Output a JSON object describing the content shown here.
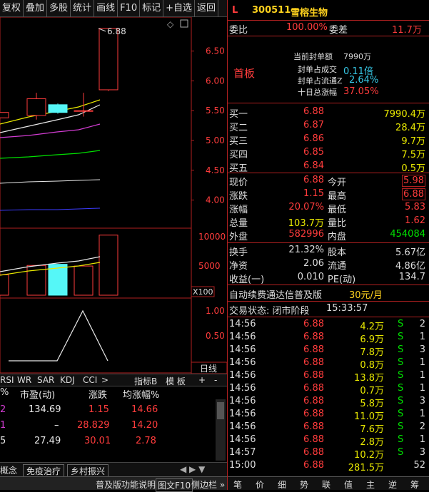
{
  "toolbar": [
    "复权",
    "叠加",
    "多股",
    "统计",
    "画线",
    "F10",
    "标记",
    "+自选",
    "返回"
  ],
  "price_axis": [
    "6.50",
    "6.00",
    "5.50",
    "5.00",
    "4.50",
    "4.00"
  ],
  "peak_label": "6.88",
  "vol_axis": [
    "10000",
    "5000"
  ],
  "vol_unit": "X100",
  "ind_axis": [
    "1.00",
    "0.50"
  ],
  "period_label": "日线",
  "ind_tabs": [
    "RSI",
    "WR",
    "SAR",
    "KDJ",
    "CCI",
    ">"
  ],
  "ind_tab_extra": [
    "指标B",
    "模 板",
    "+",
    "-"
  ],
  "table_headers": [
    "%",
    "市盈(动)",
    "涨跌",
    "均涨幅%"
  ],
  "table_rows": [
    {
      "a": "2",
      "b": "134.69",
      "c": "1.15",
      "d": "14.66"
    },
    {
      "a": "1",
      "b": "–",
      "c": "28.829",
      "d": "14.20"
    },
    {
      "a": "5",
      "b": "27.49",
      "c": "30.01",
      "d": "2.78"
    }
  ],
  "concept_tabs": [
    "概念",
    "免疫治疗",
    "乡村振兴"
  ],
  "header": {
    "flag": "L",
    "code": "300511",
    "name": "雪榕生物"
  },
  "weibi": {
    "label": "委比",
    "value": "100.00%",
    "label2": "委差",
    "value2": "11.7万"
  },
  "board": {
    "title": "首板",
    "lines": [
      {
        "k": "当前封单额",
        "v": "7990万"
      },
      {
        "k": "封单占成交",
        "v": "0.11倍"
      },
      {
        "k": "封单占流通Z",
        "v": "2.64%"
      },
      {
        "k": "十日总涨幅",
        "v": "37.05%"
      }
    ]
  },
  "bids": [
    {
      "label": "买一",
      "price": "6.88",
      "vol": "7990.4万"
    },
    {
      "label": "买二",
      "price": "6.87",
      "vol": "28.4万"
    },
    {
      "label": "买三",
      "price": "6.86",
      "vol": "9.7万"
    },
    {
      "label": "买四",
      "price": "6.85",
      "vol": "7.5万"
    },
    {
      "label": "买五",
      "price": "6.84",
      "vol": "0.5万"
    }
  ],
  "quote": [
    {
      "k1": "现价",
      "v1": "6.88",
      "k2": "今开",
      "v2": "5.98"
    },
    {
      "k1": "涨跌",
      "v1": "1.15",
      "k2": "最高",
      "v2": "6.88"
    },
    {
      "k1": "涨幅",
      "v1": "20.07%",
      "k2": "最低",
      "v2": "5.83"
    },
    {
      "k1": "总量",
      "v1": "103.7万",
      "k2": "量比",
      "v2": "1.62"
    },
    {
      "k1": "外盘",
      "v1": "582996",
      "k2": "内盘",
      "v2": "454084"
    }
  ],
  "fund": [
    {
      "k1": "换手",
      "v1": "21.32%",
      "k2": "股本",
      "v2": "5.67亿"
    },
    {
      "k1": "净资",
      "v1": "2.06",
      "k2": "流通",
      "v2": "4.86亿"
    },
    {
      "k1": "收益(一)",
      "v1": "0.010",
      "k2": "PE(动)",
      "v2": "134.7"
    }
  ],
  "promo": {
    "text": "自动续费通达信普及版",
    "price": "30元/月"
  },
  "trade_status": {
    "label": "交易状态: 闭市阶段",
    "time": "15:33:57"
  },
  "ticks": [
    {
      "t": "14:56",
      "p": "6.88",
      "v": "4.2万",
      "s": "S",
      "n": "2"
    },
    {
      "t": "14:56",
      "p": "6.88",
      "v": "6.9万",
      "s": "S",
      "n": "1"
    },
    {
      "t": "14:56",
      "p": "6.88",
      "v": "7.8万",
      "s": "S",
      "n": "3"
    },
    {
      "t": "14:56",
      "p": "6.88",
      "v": "0.8万",
      "s": "S",
      "n": "1"
    },
    {
      "t": "14:56",
      "p": "6.88",
      "v": "13.8万",
      "s": "S",
      "n": "1"
    },
    {
      "t": "14:56",
      "p": "6.88",
      "v": "0.7万",
      "s": "S",
      "n": "1"
    },
    {
      "t": "14:56",
      "p": "6.88",
      "v": "5.8万",
      "s": "S",
      "n": "3"
    },
    {
      "t": "14:56",
      "p": "6.88",
      "v": "11.0万",
      "s": "S",
      "n": "1"
    },
    {
      "t": "14:56",
      "p": "6.88",
      "v": "7.6万",
      "s": "S",
      "n": "2"
    },
    {
      "t": "14:56",
      "p": "6.88",
      "v": "2.8万",
      "s": "S",
      "n": "1"
    },
    {
      "t": "14:57",
      "p": "6.88",
      "v": "10.2万",
      "s": "S",
      "n": "3"
    },
    {
      "t": "15:00",
      "p": "6.88",
      "v": "281.5万",
      "s": "",
      "n": "52"
    }
  ],
  "right_tabs": [
    "笔",
    "价",
    "细",
    "势",
    "联",
    "值",
    "主",
    "逆",
    "筹"
  ],
  "bottom": {
    "text": "普及版功能说明",
    "btn1": "图文F10",
    "btn2": "侧边栏 »"
  },
  "chart_data": {
    "type": "candlestick",
    "ylim": [
      3.6,
      6.95
    ],
    "candles": [
      {
        "o": 5.38,
        "c": 5.47,
        "h": 5.47,
        "l": 5.38
      },
      {
        "o": 5.42,
        "c": 5.7,
        "h": 5.8,
        "l": 5.35
      },
      {
        "o": 5.6,
        "c": 5.47,
        "h": 5.62,
        "l": 5.45
      },
      {
        "o": 5.5,
        "c": 5.5,
        "h": 5.8,
        "l": 5.4
      },
      {
        "o": 5.85,
        "c": 6.88,
        "h": 6.88,
        "l": 5.83
      }
    ],
    "volumes": [
      3500,
      5100,
      5300,
      5000,
      10300
    ],
    "indicator": [
      0.0,
      0.0,
      0.0,
      1.0,
      0.0
    ]
  }
}
